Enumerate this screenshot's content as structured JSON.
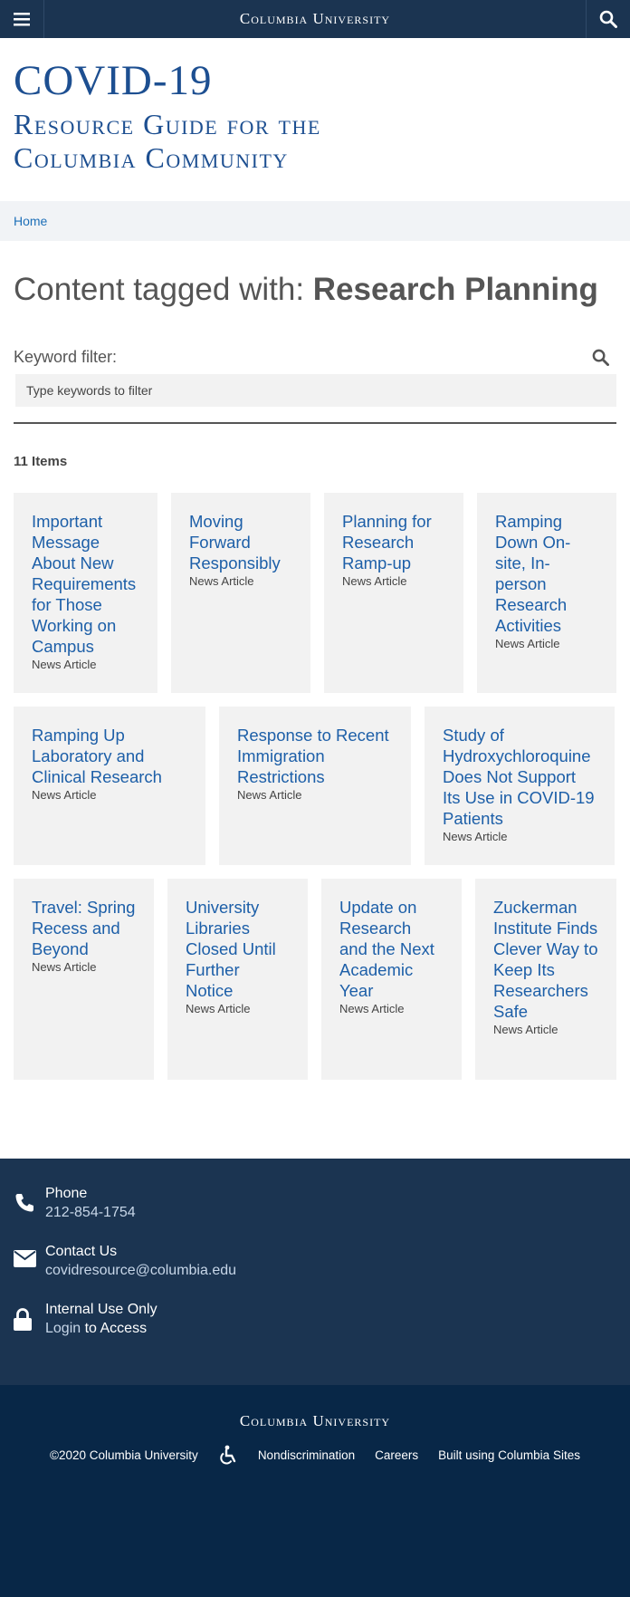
{
  "topbar": {
    "brand": "Columbia University",
    "menu_icon": "hamburger-menu-icon",
    "search_icon": "search-icon"
  },
  "header": {
    "title": "COVID-19",
    "subtitle_line1": "Resource Guide for the",
    "subtitle_line2": "Columbia Community"
  },
  "breadcrumb": {
    "home": "Home"
  },
  "page": {
    "title_prefix": "Content tagged with: ",
    "title_tag": "Research Planning"
  },
  "filter": {
    "label": "Keyword filter:",
    "placeholder": "Type keywords to filter",
    "value": ""
  },
  "results": {
    "count": "11 Items"
  },
  "cards": [
    {
      "title": "Important Message About New Requirements for Those Working on Campus",
      "type": "News Article"
    },
    {
      "title": "Moving Forward Responsibly",
      "type": "News Article"
    },
    {
      "title": "Planning for Research Ramp-up",
      "type": "News Article"
    },
    {
      "title": "Ramping Down On-site, In-person Research Activities",
      "type": "News Article"
    },
    {
      "title": "Ramping Up Laboratory and Clinical Research",
      "type": "News Article"
    },
    {
      "title": "Response to Recent Immigration Restrictions",
      "type": "News Article"
    },
    {
      "title": "Study of Hydroxychloroquine Does Not Support Its Use in COVID-19 Patients",
      "type": "News Article"
    },
    {
      "title": "Travel: Spring Recess and Beyond",
      "type": "News Article"
    },
    {
      "title": "University Libraries Closed Until Further Notice",
      "type": "News Article"
    },
    {
      "title": "Update on Research and the Next Academic Year",
      "type": "News Article"
    },
    {
      "title": "Zuckerman Institute Finds Clever Way to Keep Its Researchers Safe",
      "type": "News Article"
    }
  ],
  "footer": {
    "phone_label": "Phone",
    "phone_value": "212-854-1754",
    "contact_label": "Contact Us",
    "contact_value": "covidresource@columbia.edu",
    "internal_label": "Internal Use Only",
    "internal_link": "Login",
    "internal_suffix": " to Access"
  },
  "bottom": {
    "brand": "Columbia University",
    "copyright": "©2020 Columbia University",
    "accessibility_icon": "accessibility-icon",
    "links": [
      "Nondiscrimination",
      "Careers",
      "Built using Columbia Sites"
    ]
  },
  "colors": {
    "navy": "#1b3451",
    "dark_navy": "#082747",
    "link_blue": "#1d5fa8",
    "card_bg": "#f2f2f2"
  }
}
